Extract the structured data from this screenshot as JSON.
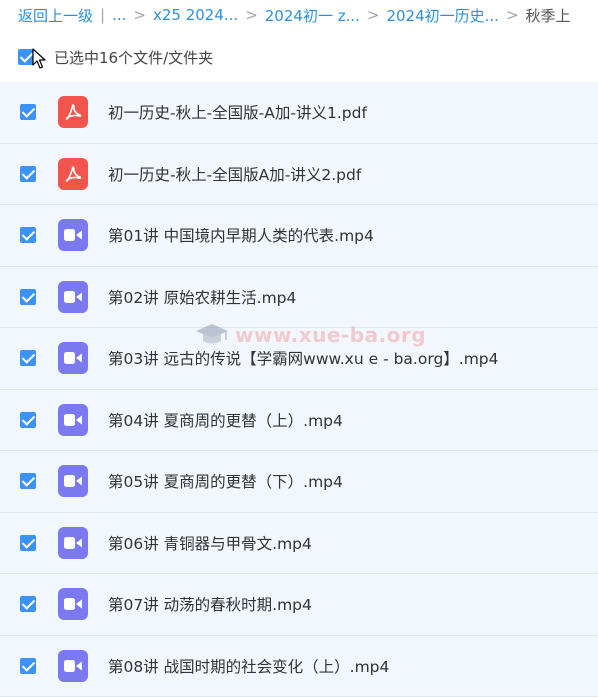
{
  "breadcrumb": {
    "items": [
      "返回上一级",
      "...",
      "x25 2024...",
      "2024初一 z...",
      "2024初一历史..."
    ],
    "current": "秋季上"
  },
  "selection": {
    "label": "已选中16个文件/文件夹",
    "checked": true
  },
  "files": [
    {
      "name": "初一历史-秋上-全国版-A加-讲义1.pdf",
      "type": "pdf",
      "icon": "pdf-icon",
      "checked": true
    },
    {
      "name": "初一历史-秋上-全国版A加-讲义2.pdf",
      "type": "pdf",
      "icon": "pdf-icon",
      "checked": true
    },
    {
      "name": "第01讲 中国境内早期人类的代表.mp4",
      "type": "video",
      "icon": "video-icon",
      "checked": true
    },
    {
      "name": "第02讲 原始农耕生活.mp4",
      "type": "video",
      "icon": "video-icon",
      "checked": true
    },
    {
      "name": "第03讲 远古的传说【学霸网www.xu e - ba.org】.mp4",
      "type": "video",
      "icon": "video-icon",
      "checked": true
    },
    {
      "name": "第04讲 夏商周的更替（上）.mp4",
      "type": "video",
      "icon": "video-icon",
      "checked": true
    },
    {
      "name": "第05讲 夏商周的更替（下）.mp4",
      "type": "video",
      "icon": "video-icon",
      "checked": true
    },
    {
      "name": "第06讲 青铜器与甲骨文.mp4",
      "type": "video",
      "icon": "video-icon",
      "checked": true
    },
    {
      "name": "第07讲 动荡的春秋时期.mp4",
      "type": "video",
      "icon": "video-icon",
      "checked": true
    },
    {
      "name": "第08讲 战国时期的社会变化（上）.mp4",
      "type": "video",
      "icon": "video-icon",
      "checked": true
    }
  ],
  "watermark": {
    "text": "www.xue-ba.org"
  },
  "colors": {
    "link": "#2f8fdb",
    "checkbox": "#3d93f5",
    "pdf": "#f2554d",
    "video": "#7b79f0",
    "row_bg": "#f1f7fd"
  }
}
